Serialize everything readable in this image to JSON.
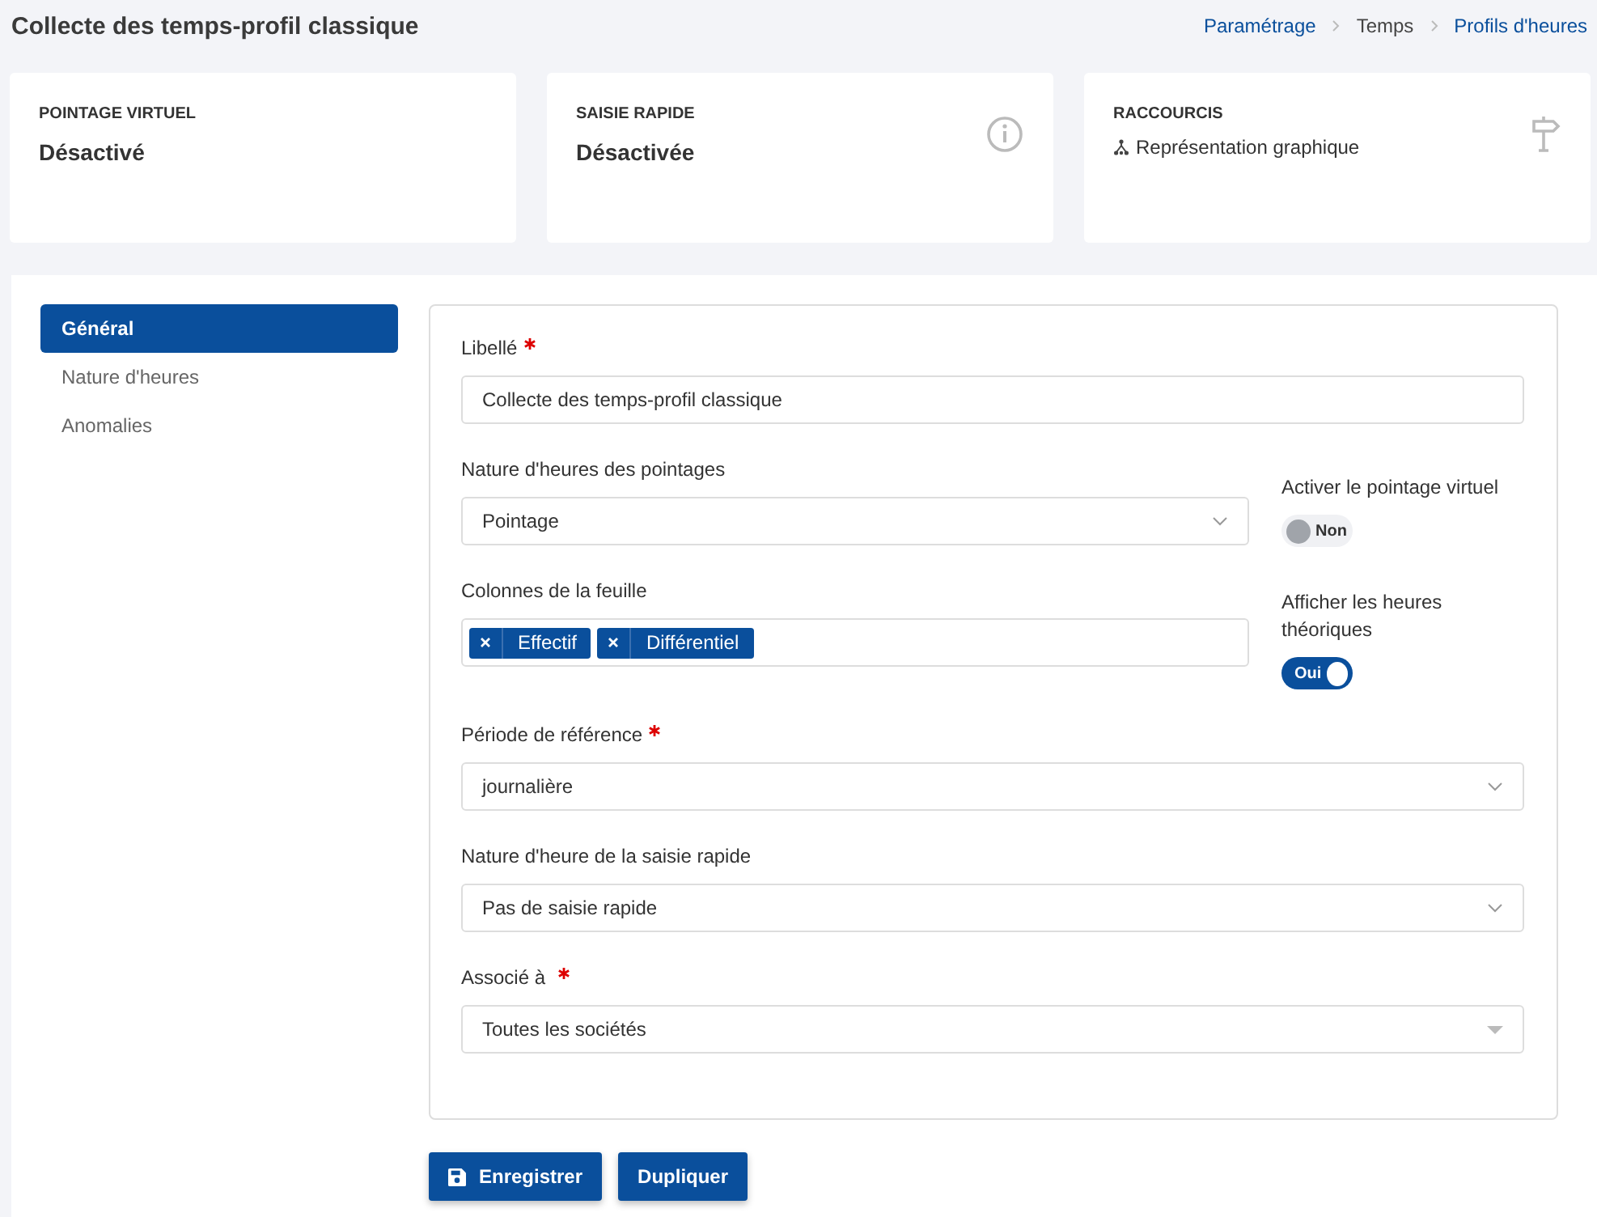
{
  "header": {
    "title": "Collecte des temps-profil classique",
    "breadcrumb": [
      {
        "label": "Paramétrage",
        "link": true
      },
      {
        "label": "Temps",
        "link": false
      },
      {
        "label": "Profils d'heures",
        "link": true
      }
    ]
  },
  "cards": [
    {
      "label": "POINTAGE VIRTUEL",
      "value": "Désactivé",
      "kind": "status"
    },
    {
      "label": "SAISIE RAPIDE",
      "value": "Désactivée",
      "kind": "info"
    },
    {
      "label": "RACCOURCIS",
      "link": "Représentation graphique",
      "kind": "shortcut"
    }
  ],
  "sidebar": {
    "items": [
      {
        "label": "Général",
        "selected": true
      },
      {
        "label": "Nature d'heures",
        "selected": false
      },
      {
        "label": "Anomalies",
        "selected": false
      }
    ]
  },
  "form": {
    "libelle": {
      "label": "Libellé",
      "required": true,
      "value": "Collecte des temps-profil classique"
    },
    "nature_pointages": {
      "label": "Nature d'heures des pointages",
      "value": "Pointage"
    },
    "colonnes": {
      "label": "Colonnes de la feuille",
      "tags": [
        "Effectif",
        "Différentiel"
      ]
    },
    "toggles": [
      {
        "label": "Activer le pointage virtuel",
        "on": false,
        "text": "Non"
      },
      {
        "label": "Afficher les heures théoriques",
        "on": true,
        "text": "Oui"
      }
    ],
    "periode": {
      "label": "Période de référence",
      "required": true,
      "value": "journalière"
    },
    "nature_saisie": {
      "label": "Nature d'heure de la saisie rapide",
      "required": false,
      "value": "Pas de saisie rapide"
    },
    "associe": {
      "label": "Associé à",
      "required": true,
      "value": "Toutes les sociétés"
    }
  },
  "buttons": [
    {
      "label": "Enregistrer",
      "icon": true
    },
    {
      "label": "Dupliquer",
      "icon": false
    }
  ]
}
